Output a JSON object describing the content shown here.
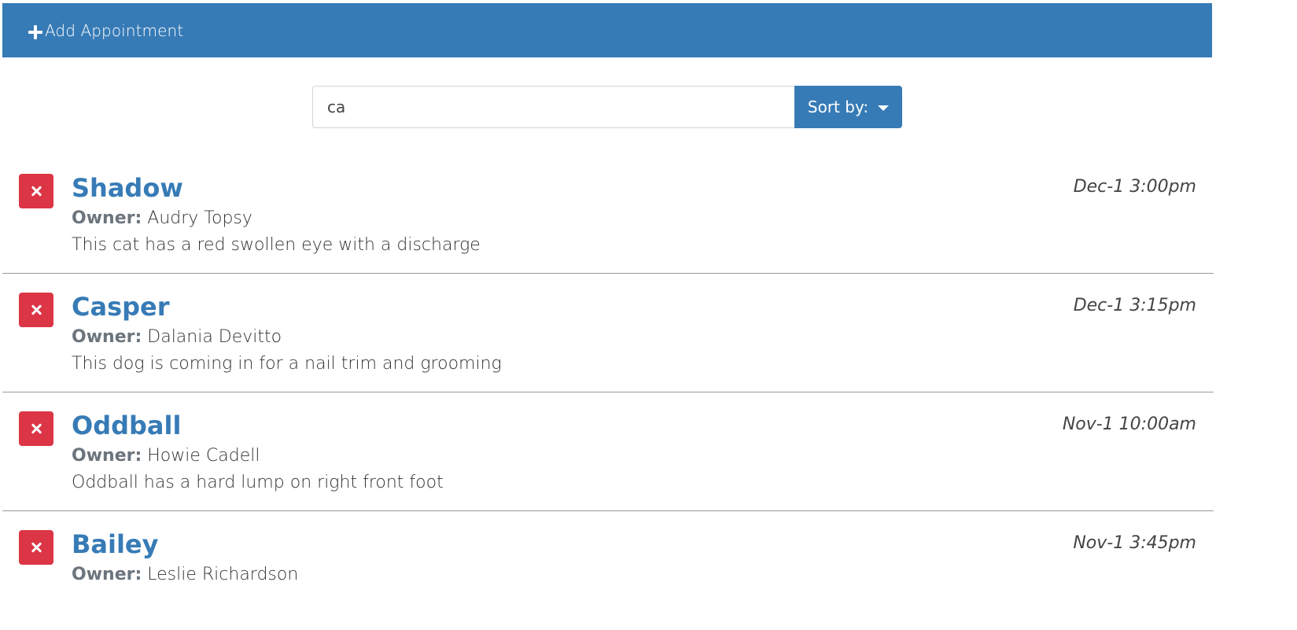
{
  "header": {
    "add_label": "Add Appointment"
  },
  "search": {
    "value": "ca",
    "sort_label": "Sort by:"
  },
  "appointments": [
    {
      "pet_name": "Shadow",
      "owner_label": "Owner:",
      "owner_name": "Audry Topsy",
      "notes": "This cat has a red swollen eye with a discharge",
      "date": "Dec-1 3:00pm"
    },
    {
      "pet_name": "Casper",
      "owner_label": "Owner:",
      "owner_name": "Dalania Devitto",
      "notes": "This dog is coming in for a nail trim and grooming",
      "date": "Dec-1 3:15pm"
    },
    {
      "pet_name": "Oddball",
      "owner_label": "Owner:",
      "owner_name": "Howie Cadell",
      "notes": "Oddball has a hard lump on right front foot",
      "date": "Nov-1 10:00am"
    },
    {
      "pet_name": "Bailey",
      "owner_label": "Owner:",
      "owner_name": "Leslie Richardson",
      "notes": "",
      "date": "Nov-1 3:45pm"
    }
  ],
  "colors": {
    "primary": "#377bb6",
    "danger": "#dc3545",
    "muted": "#6c757d"
  },
  "icons": {
    "add": "plus-icon",
    "delete": "close-icon",
    "sort": "caret-down-icon"
  }
}
